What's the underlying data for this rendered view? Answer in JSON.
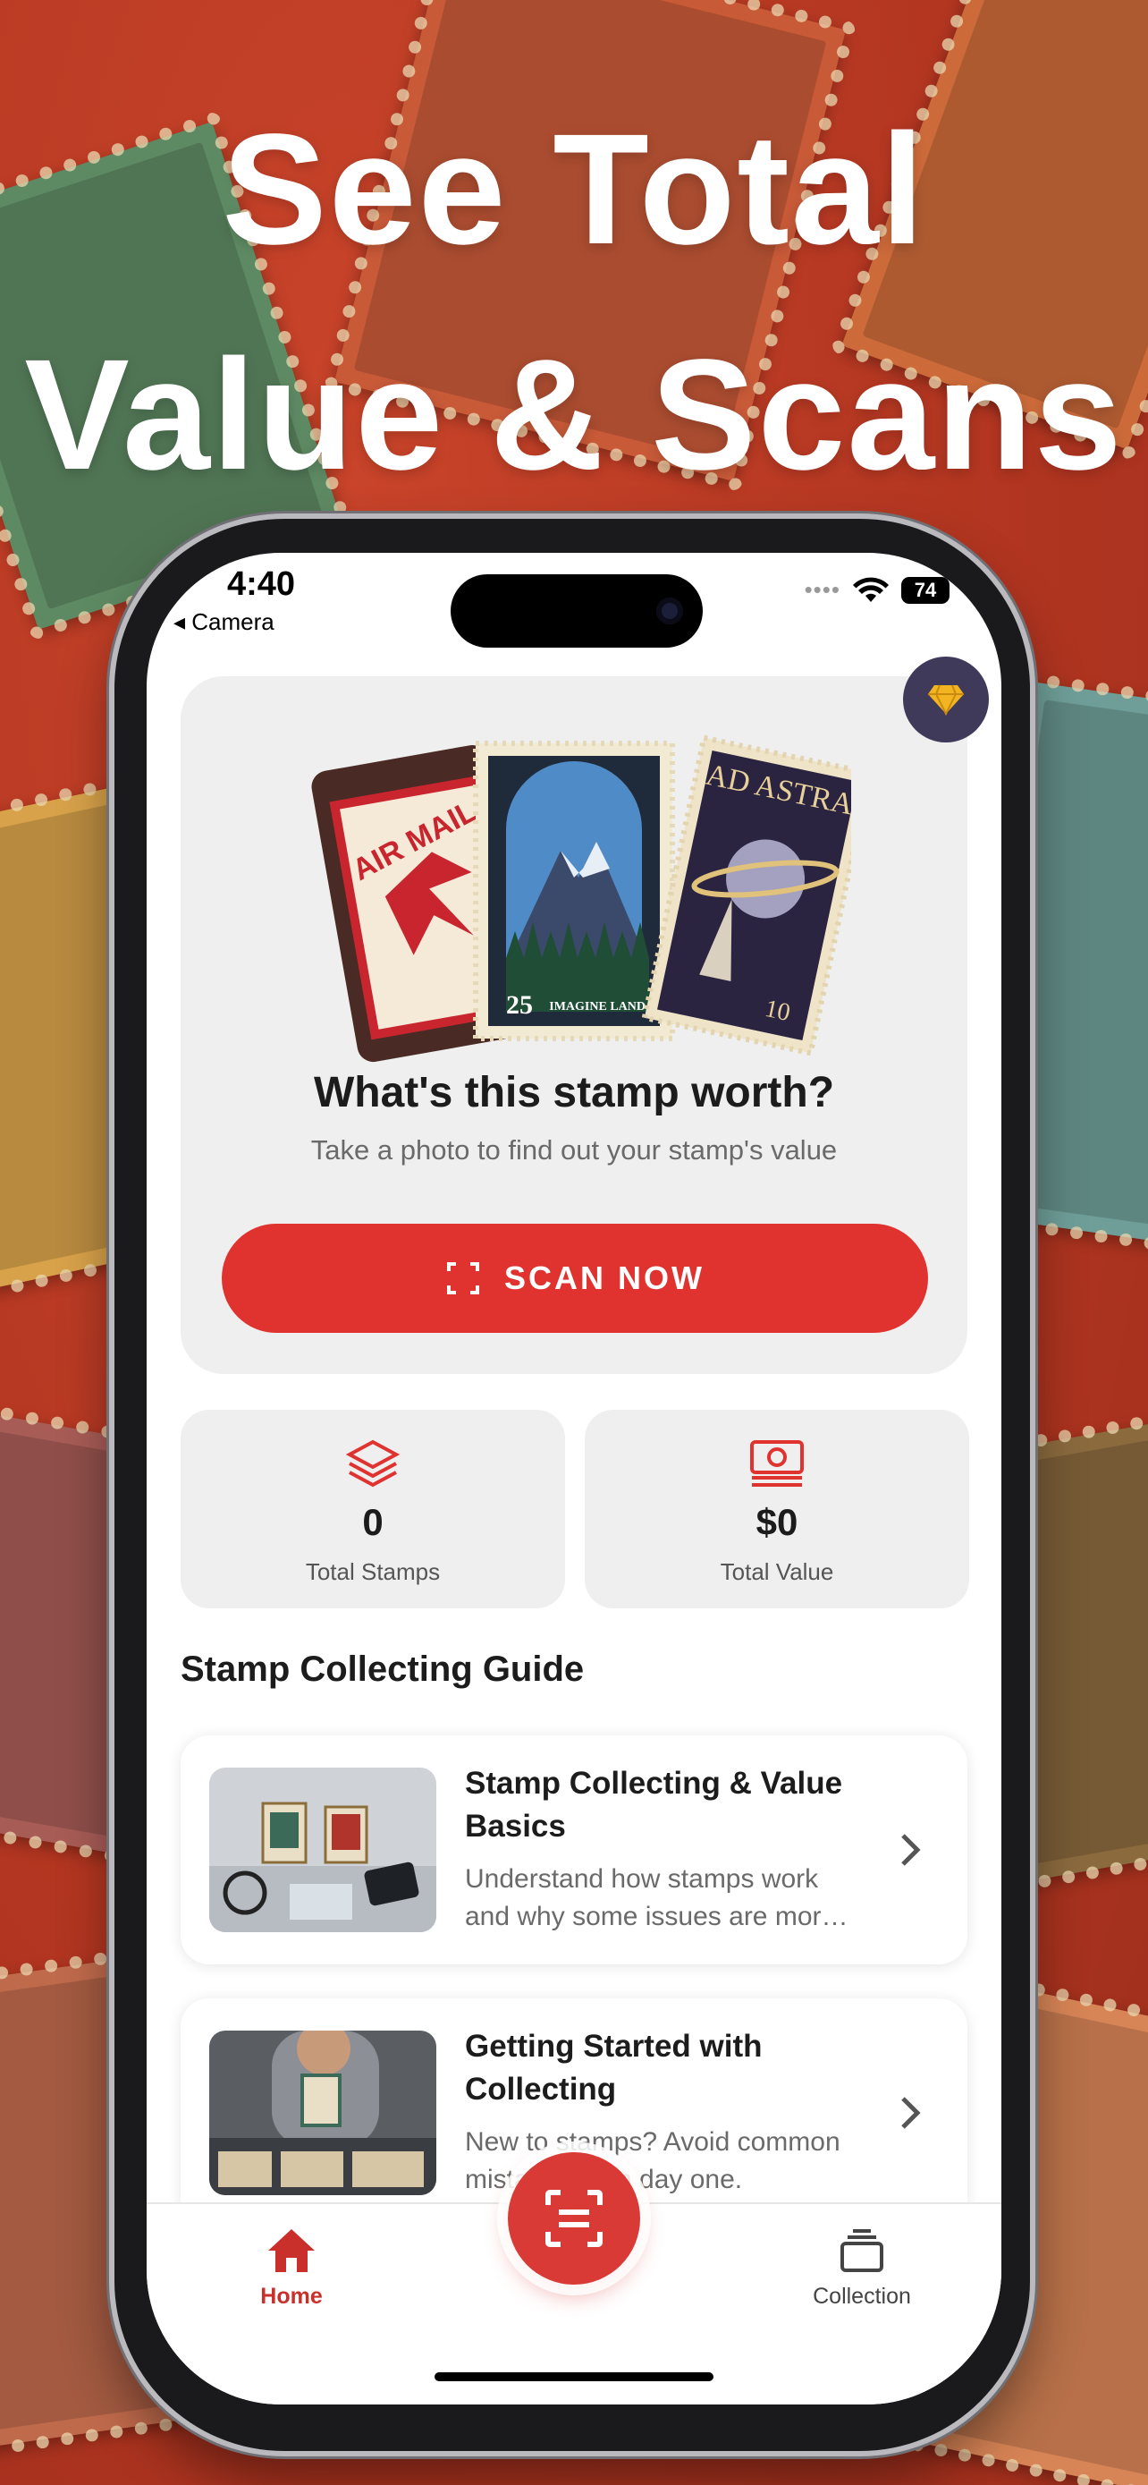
{
  "headline": {
    "line1": "See Total",
    "line2": "Value & Scans"
  },
  "status_bar": {
    "time": "4:40",
    "back_label": "◂ Camera",
    "battery": "74"
  },
  "hero": {
    "stamps": {
      "airmail_text": "AIR MAIL",
      "landscape_value": "25",
      "landscape_caption": "IMAGINE LAND",
      "space_title": "AD ASTRA",
      "space_value": "10"
    },
    "title": "What's this stamp worth?",
    "subtitle": "Take a photo to find out your stamp's value",
    "scan_button": "SCAN NOW"
  },
  "stats": [
    {
      "value": "0",
      "label": "Total Stamps",
      "icon": "layers-icon"
    },
    {
      "value": "$0",
      "label": "Total Value",
      "icon": "cash-icon"
    }
  ],
  "guide": {
    "title": "Stamp Collecting Guide",
    "items": [
      {
        "title": "Stamp Collecting & Value Basics",
        "description": "Understand how stamps work and why some issues are mor…"
      },
      {
        "title": "Getting Started with Collecting",
        "description": "New to stamps? Avoid common mistakes from day one."
      }
    ]
  },
  "tabbar": {
    "home": "Home",
    "collection": "Collection"
  },
  "colors": {
    "accent": "#e0322f",
    "premium_bg": "#3f3a5a",
    "gold": "#f2b420"
  }
}
